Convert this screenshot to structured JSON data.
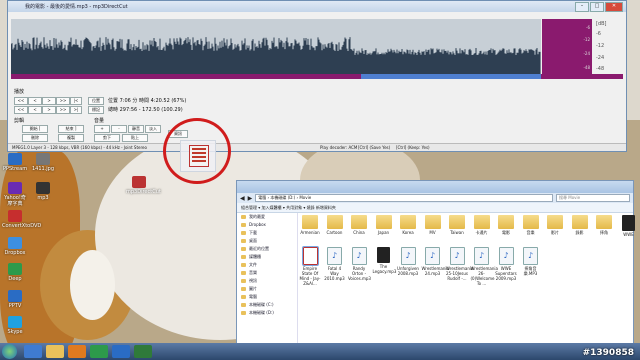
{
  "app": {
    "title": "我的電影 - 最後的愛情.mp3 - mp3DirectCut",
    "menu": [
      "檔案",
      "編輯",
      "特殊",
      "設定",
      "?"
    ],
    "scale": [
      "[dB]",
      "-6",
      "-12",
      "-24",
      "-48"
    ],
    "meter_labels": [
      "-6",
      "-12",
      "-24",
      "-48"
    ],
    "playback_label": "播放",
    "transport": [
      "<<",
      "<",
      ">",
      ">>",
      "|<",
      ">|"
    ],
    "position_label": "位置",
    "marker_label": "標記",
    "time_line1": "位置 7:06 分  時間 4:20.52  (67%)",
    "time_line2": "總時 297:56 - 172.50 (100.29)",
    "cut_label": "剪輯",
    "cut_buttons": [
      "開始 [",
      "結束 ]",
      "刪除",
      "複製",
      "剪下",
      "貼上"
    ],
    "vol_label": "音量",
    "vol_buttons": [
      "+",
      "-",
      "靜音",
      "淡入",
      "淡出"
    ],
    "info_button": "資訊",
    "status_left": "MPEG1.0 Layer 3 - 128 kbps, VBR (160 kbps) - 44 kHz - Joint Stereo",
    "status_mid": "Play decoder: ACM",
    "status_mid2": "[Ctrl] (Save Yes)",
    "status_right": "[Ctrl] (Keep: Yes)"
  },
  "desktop_icons": [
    {
      "label": "PPStream",
      "color": "#2a6cc4"
    },
    {
      "label": "Yahoo!奇摩字典",
      "color": "#6a2bb3"
    },
    {
      "label": "ConvertXtoDVD",
      "color": "#c62e2e"
    },
    {
      "label": "Dropbox",
      "color": "#3d8fe0"
    },
    {
      "label": "Deep",
      "color": "#2d9a4b"
    },
    {
      "label": "PPTV",
      "color": "#2a6cc4"
    },
    {
      "label": "Skype",
      "color": "#1fa1e0"
    },
    {
      "label": "1411.jpg",
      "color": "#777"
    },
    {
      "label": "mp3",
      "color": "#333"
    },
    {
      "label": "mp3DirectCut",
      "color": "#b33"
    }
  ],
  "explorer": {
    "address": "電腦 › 本機磁碟 (D:) › Movie",
    "search_placeholder": "搜尋 Movie",
    "commands": "組合管理 ▾   加入媒體櫃 ▾   共用對象 ▾   燒錄   新增資料夾",
    "nav": [
      "我的最愛",
      "Dropbox",
      "下載",
      "桌面",
      "最近的位置",
      "媒體櫃",
      "文件",
      "音樂",
      "視訊",
      "圖片",
      "電腦",
      "本機磁碟 (C:)",
      "本機磁碟 (D:)"
    ],
    "files": [
      {
        "name": "Armenian",
        "type": "folder"
      },
      {
        "name": "Cartoon",
        "type": "folder"
      },
      {
        "name": "China",
        "type": "folder"
      },
      {
        "name": "Japan",
        "type": "folder"
      },
      {
        "name": "Korea",
        "type": "folder"
      },
      {
        "name": "MV",
        "type": "folder"
      },
      {
        "name": "Taiwan",
        "type": "folder"
      },
      {
        "name": "卡通片",
        "type": "folder"
      },
      {
        "name": "電影",
        "type": "folder"
      },
      {
        "name": "音樂",
        "type": "folder"
      },
      {
        "name": "影片",
        "type": "folder"
      },
      {
        "name": "錄影",
        "type": "folder"
      },
      {
        "name": "摔角",
        "type": "folder"
      },
      {
        "name": "WWE",
        "type": "dark"
      },
      {
        "name": "Empire State Of Mind - Jay-Z&Al...",
        "type": "mp3"
      },
      {
        "name": "Fatal 4 Way 2010.mp3",
        "type": "audio"
      },
      {
        "name": "Randy Orton - Voices.mp3",
        "type": "audio"
      },
      {
        "name": "The Legacy.mp3",
        "type": "dark"
      },
      {
        "name": "Unforgiven 2008.mp3",
        "type": "audio"
      },
      {
        "name": "Wrestlemania 24.mp3",
        "type": "audio"
      },
      {
        "name": "Wrestlemania 25-10Jesus Rudolf -...",
        "type": "audio"
      },
      {
        "name": "Wrestlemania 26-(0)Welcome To ...",
        "type": "audio"
      },
      {
        "name": "WWE Superstars 2009.mp3",
        "type": "audio"
      },
      {
        "name": "摔角音樂.MP3",
        "type": "audio"
      }
    ]
  },
  "watermark": "#1390858"
}
